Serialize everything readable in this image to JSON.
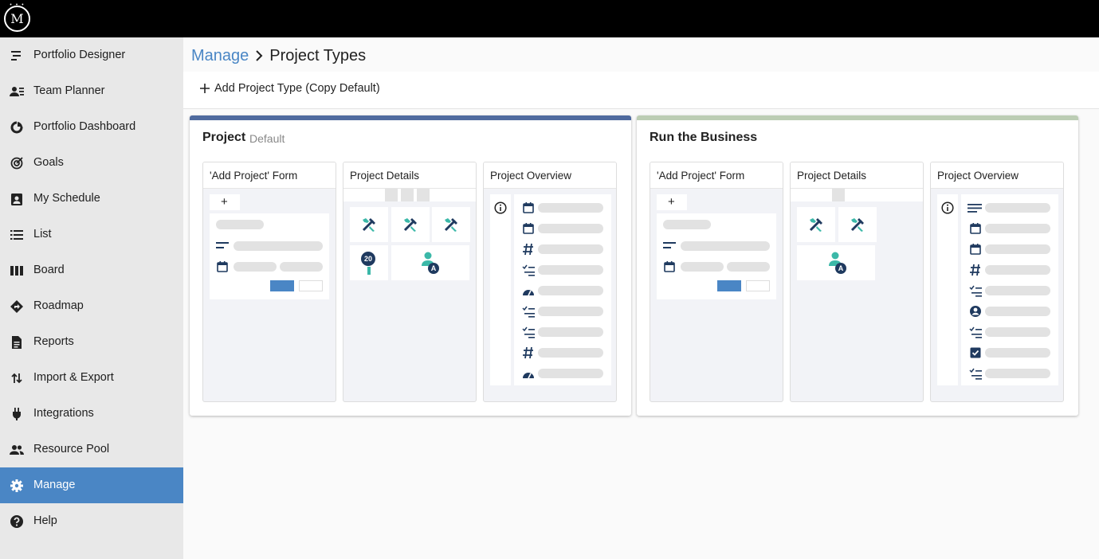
{
  "app": {
    "logo_text": "M",
    "logo_small": "• • •"
  },
  "sidebar": {
    "items": [
      {
        "label": "Portfolio Designer",
        "icon": "portfolio-designer-icon"
      },
      {
        "label": "Team Planner",
        "icon": "team-planner-icon"
      },
      {
        "label": "Portfolio Dashboard",
        "icon": "dashboard-icon"
      },
      {
        "label": "Goals",
        "icon": "goals-icon"
      },
      {
        "label": "My Schedule",
        "icon": "schedule-icon"
      },
      {
        "label": "List",
        "icon": "list-icon"
      },
      {
        "label": "Board",
        "icon": "board-icon"
      },
      {
        "label": "Roadmap",
        "icon": "roadmap-icon"
      },
      {
        "label": "Reports",
        "icon": "reports-icon"
      },
      {
        "label": "Import & Export",
        "icon": "import-export-icon"
      },
      {
        "label": "Integrations",
        "icon": "plug-icon"
      },
      {
        "label": "Resource Pool",
        "icon": "people-icon"
      },
      {
        "label": "Manage",
        "icon": "gear-icon",
        "active": true
      },
      {
        "label": "Help",
        "icon": "help-icon"
      }
    ]
  },
  "header": {
    "breadcrumb_link": "Manage",
    "breadcrumb_current": "Project Types",
    "add_button_label": "Add Project Type (Copy Default)"
  },
  "project_types": [
    {
      "title": "Project",
      "subtitle": "Default",
      "accent_color": "#4f6a9e",
      "panels": {
        "form": "'Add Project' Form",
        "form_button": "+",
        "details": "Project Details",
        "details_badge": "20",
        "details_avatar_letter": "A",
        "overview": "Project Overview"
      }
    },
    {
      "title": "Run the Business",
      "subtitle": "",
      "accent_color": "#bccdb4",
      "panels": {
        "form": "'Add Project' Form",
        "form_button": "+",
        "details": "Project Details",
        "details_avatar_letter": "A",
        "overview": "Project Overview"
      }
    }
  ],
  "colors": {
    "accent": "#4a86c5",
    "icon_navy": "#1f3a5f",
    "icon_teal": "#3bb8a8"
  }
}
